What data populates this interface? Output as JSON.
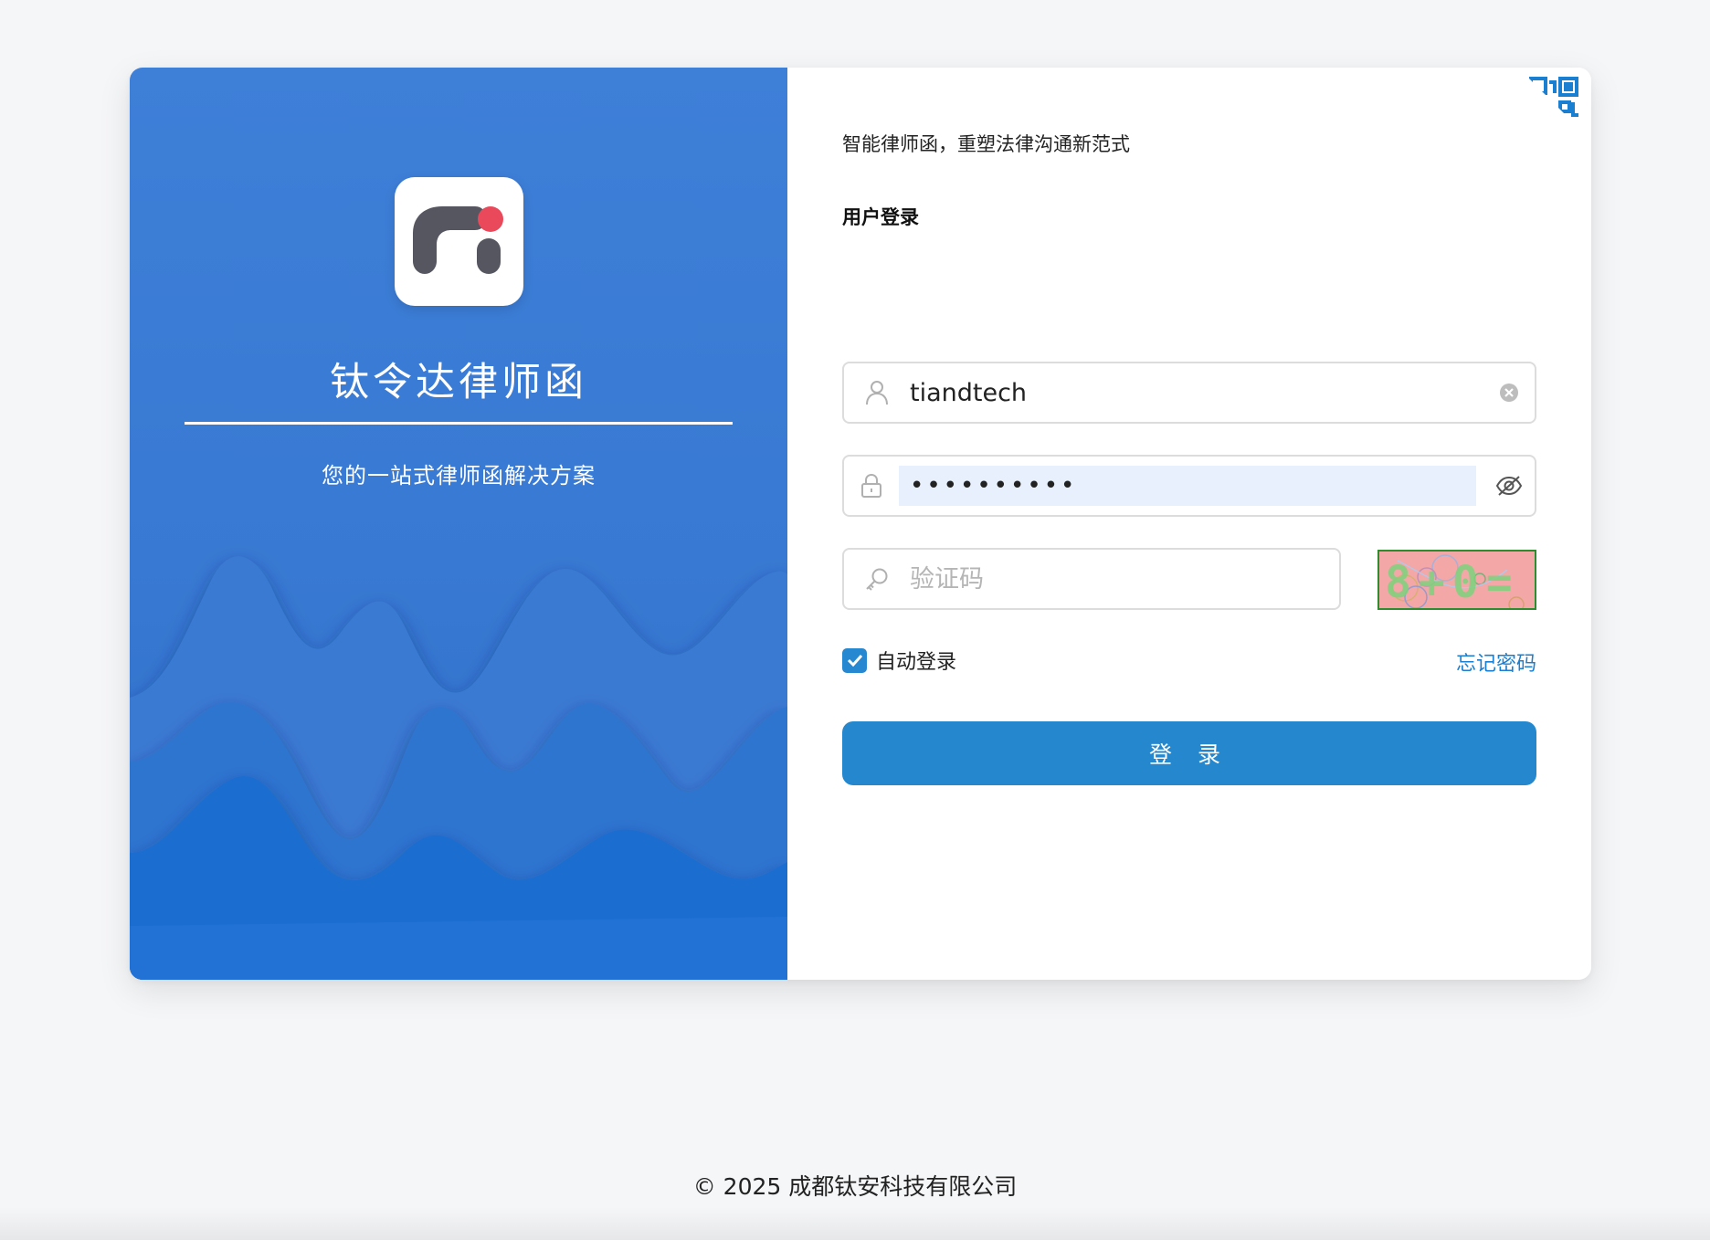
{
  "brand": {
    "title": "钛令达律师函",
    "subtitle": "您的一站式律师函解决方案",
    "logo_text": "ri",
    "colors": {
      "panel_blue": "#3a7bd5",
      "logo_dark": "#555660",
      "logo_dot": "#e9495a"
    }
  },
  "login": {
    "slogan": "智能律师函，重塑法律沟通新范式",
    "title": "用户登录",
    "qr_icon": "qr-code-icon",
    "username": {
      "value": "tiandtech",
      "icon": "user-icon",
      "clear_icon": "clear-icon"
    },
    "password": {
      "value": "abcdefghij",
      "icon": "lock-icon",
      "toggle_icon": "eye-off-icon"
    },
    "captcha": {
      "placeholder": "验证码",
      "icon": "key-icon",
      "image_text": "8+0="
    },
    "auto_login": {
      "label": "自动登录",
      "checked": true
    },
    "forgot_password": "忘记密码",
    "submit_label": "登 录",
    "accent_color": "#2588ce"
  },
  "footer": {
    "copyright": "© 2025 成都钛安科技有限公司"
  }
}
